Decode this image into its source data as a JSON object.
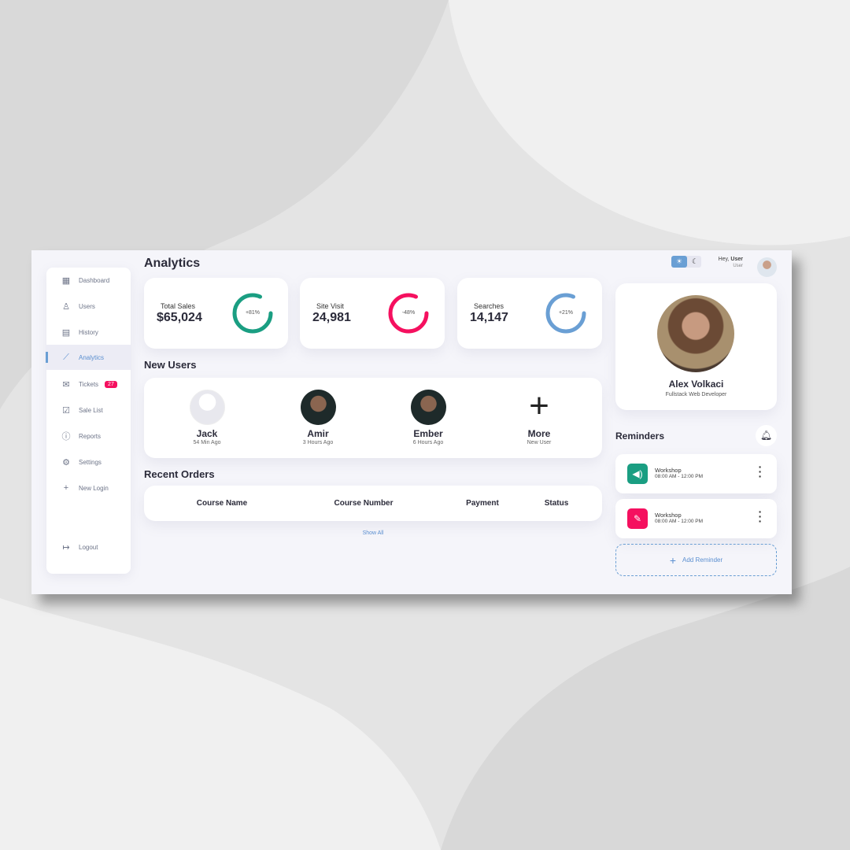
{
  "colors": {
    "accent": "#6a9fd4",
    "green": "#1a9e82",
    "pink": "#f5105f"
  },
  "page_title": "Analytics",
  "sidebar": {
    "items": [
      {
        "label": "Dashboard",
        "icon": "dashboard-icon"
      },
      {
        "label": "Users",
        "icon": "user-icon"
      },
      {
        "label": "History",
        "icon": "history-icon"
      },
      {
        "label": "Analytics",
        "icon": "analytics-icon",
        "active": true
      },
      {
        "label": "Tickets",
        "icon": "mail-icon",
        "badge": "27"
      },
      {
        "label": "Sale List",
        "icon": "clipboard-check-icon"
      },
      {
        "label": "Reports",
        "icon": "alert-circle-icon"
      },
      {
        "label": "Settings",
        "icon": "gear-icon"
      },
      {
        "label": "New Login",
        "icon": "plus-icon"
      }
    ],
    "logout": "Logout"
  },
  "stats": [
    {
      "label": "Total Sales",
      "value": "$65,024",
      "change": "+81%",
      "color": "#1a9e82"
    },
    {
      "label": "Site Visit",
      "value": "24,981",
      "change": "-48%",
      "color": "#f5105f"
    },
    {
      "label": "Searches",
      "value": "14,147",
      "change": "+21%",
      "color": "#6a9fd4"
    }
  ],
  "new_users": {
    "title": "New Users",
    "users": [
      {
        "name": "Jack",
        "time": "54 Min Ago"
      },
      {
        "name": "Amir",
        "time": "3 Hours Ago"
      },
      {
        "name": "Ember",
        "time": "6 Hours Ago"
      }
    ],
    "more": {
      "name": "More",
      "sub": "New User"
    }
  },
  "recent_orders": {
    "title": "Recent Orders",
    "columns": [
      "Course Name",
      "Course Number",
      "Payment",
      "Status"
    ],
    "show_all": "Show All"
  },
  "header": {
    "greeting": "Hey,",
    "user_name": "User",
    "user_role": "User"
  },
  "profile": {
    "name": "Alex Volkaci",
    "role": "Fullstack Web Developer"
  },
  "reminders": {
    "title": "Reminders",
    "items": [
      {
        "title": "Workshop",
        "time": "08:00 AM - 12:00 PM",
        "icon": "volume-icon",
        "color": "#1a9e82"
      },
      {
        "title": "Workshop",
        "time": "08:00 AM - 12:00 PM",
        "icon": "pencil-icon",
        "color": "#f5105f"
      }
    ],
    "add_label": "Add Reminder"
  }
}
